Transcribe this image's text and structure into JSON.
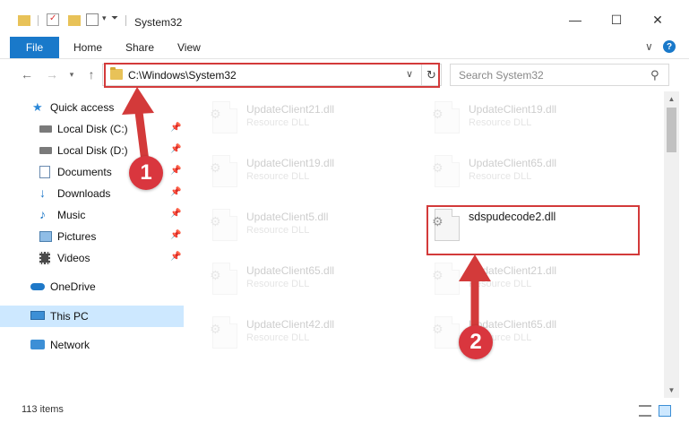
{
  "window": {
    "title": "System32",
    "minimize": "—",
    "maximize": "☐",
    "close": "✕"
  },
  "ribbon": {
    "tabs": [
      "File",
      "Home",
      "Share",
      "View"
    ],
    "help": "?"
  },
  "nav": {
    "address": "C:\\Windows\\System32",
    "search_placeholder": "Search System32"
  },
  "sidebar": {
    "items": [
      {
        "label": "Quick access",
        "icon": "star-icon",
        "pinned": false
      },
      {
        "label": "Local Disk (C:)",
        "icon": "drive-icon",
        "pinned": true
      },
      {
        "label": "Local Disk (D:)",
        "icon": "drive-icon",
        "pinned": true
      },
      {
        "label": "Documents",
        "icon": "documents-icon",
        "pinned": true
      },
      {
        "label": "Downloads",
        "icon": "download-icon",
        "pinned": true
      },
      {
        "label": "Music",
        "icon": "music-icon",
        "pinned": true
      },
      {
        "label": "Pictures",
        "icon": "pictures-icon",
        "pinned": true
      },
      {
        "label": "Videos",
        "icon": "videos-icon",
        "pinned": true
      },
      {
        "label": "OneDrive",
        "icon": "cloud-icon",
        "pinned": false
      },
      {
        "label": "This PC",
        "icon": "computer-icon",
        "pinned": false,
        "selected": true
      },
      {
        "label": "Network",
        "icon": "network-icon",
        "pinned": false
      }
    ]
  },
  "files": [
    {
      "name": "UpdateClient21.dll",
      "type": "Resource DLL",
      "faded": true
    },
    {
      "name": "UpdateClient19.dll",
      "type": "Resource DLL",
      "faded": true
    },
    {
      "name": "UpdateClient19.dll",
      "type": "Resource DLL",
      "faded": true
    },
    {
      "name": "UpdateClient65.dll",
      "type": "Resource DLL",
      "faded": true
    },
    {
      "name": "UpdateClient5.dll",
      "type": "Resource DLL",
      "faded": true
    },
    {
      "name": "sdspudecode2.dll",
      "type": "",
      "faded": false
    },
    {
      "name": "UpdateClient65.dll",
      "type": "Resource DLL",
      "faded": true
    },
    {
      "name": "UpdateClient21.dll",
      "type": "Resource DLL",
      "faded": true
    },
    {
      "name": "UpdateClient42.dll",
      "type": "Resource DLL",
      "faded": true
    },
    {
      "name": "UpdateClient65.dll",
      "type": "Resource DLL",
      "faded": true
    }
  ],
  "status": {
    "item_count": "113 items"
  },
  "annotations": {
    "step1": "1",
    "step2": "2",
    "color": "#d33a3a"
  }
}
